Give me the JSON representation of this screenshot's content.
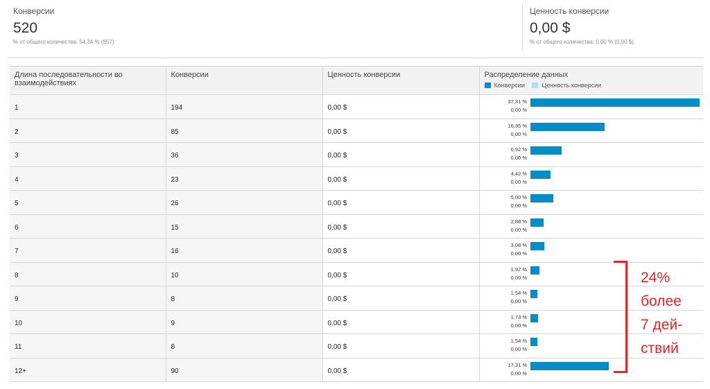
{
  "summary": [
    {
      "label": "Конверсии",
      "value": "520",
      "sub": "% от общего количества: 54,34 % (957)"
    },
    {
      "label": "Ценность конверсии",
      "value": "0,00 $",
      "sub": "% от общего количества: 0,00 % (0,00 $)"
    }
  ],
  "table": {
    "headers": [
      "Длина последовательности во взаимодействиях",
      "Конверсии",
      "Ценность конверсии",
      "Распределение данных"
    ],
    "legend": [
      {
        "label": "Конверсии",
        "color": "#058dc7"
      },
      {
        "label": "Ценность конверсии",
        "color": "#aadff3"
      }
    ],
    "max_share": 37.31,
    "rows": [
      {
        "length": "1",
        "conversions": "194",
        "value": "0,00 $",
        "share": 37.31,
        "share_label": "37,31 %",
        "value_share_label": "0,00 %"
      },
      {
        "length": "2",
        "conversions": "85",
        "value": "0,00 $",
        "share": 16.35,
        "share_label": "16,35 %",
        "value_share_label": "0,00 %"
      },
      {
        "length": "3",
        "conversions": "36",
        "value": "0,00 $",
        "share": 6.92,
        "share_label": "6,92 %",
        "value_share_label": "0,00 %"
      },
      {
        "length": "4",
        "conversions": "23",
        "value": "0,00 $",
        "share": 4.42,
        "share_label": "4,42 %",
        "value_share_label": "0,00 %"
      },
      {
        "length": "5",
        "conversions": "26",
        "value": "0,00 $",
        "share": 5.0,
        "share_label": "5,00 %",
        "value_share_label": "0,00 %"
      },
      {
        "length": "6",
        "conversions": "15",
        "value": "0,00 $",
        "share": 2.88,
        "share_label": "2,88 %",
        "value_share_label": "0,00 %"
      },
      {
        "length": "7",
        "conversions": "16",
        "value": "0,00 $",
        "share": 3.08,
        "share_label": "3,08 %",
        "value_share_label": "0,00 %"
      },
      {
        "length": "8",
        "conversions": "10",
        "value": "0,00 $",
        "share": 1.92,
        "share_label": "1,92 %",
        "value_share_label": "0,00 %"
      },
      {
        "length": "9",
        "conversions": "8",
        "value": "0,00 $",
        "share": 1.54,
        "share_label": "1,54 %",
        "value_share_label": "0,00 %"
      },
      {
        "length": "10",
        "conversions": "9",
        "value": "0,00 $",
        "share": 1.73,
        "share_label": "1,73 %",
        "value_share_label": "0,00 %"
      },
      {
        "length": "11",
        "conversions": "8",
        "value": "0,00 $",
        "share": 1.54,
        "share_label": "1,54 %",
        "value_share_label": "0,00 %"
      },
      {
        "length": "12+",
        "conversions": "90",
        "value": "0,00 $",
        "share": 17.31,
        "share_label": "17,31 %",
        "value_share_label": "0,00 %"
      }
    ]
  },
  "annotation": {
    "lines": [
      "24%",
      "более",
      "7 дей-",
      "ствий"
    ],
    "color": "#e3262a"
  }
}
